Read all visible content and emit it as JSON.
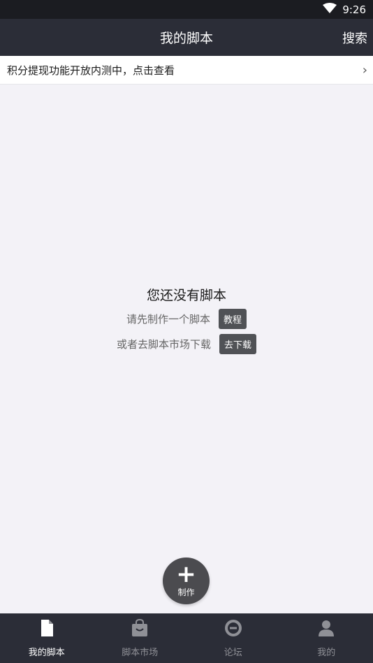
{
  "status": {
    "time": "9:26"
  },
  "header": {
    "title": "我的脚本",
    "search_label": "搜索"
  },
  "notice": {
    "text": "积分提现功能开放内测中，点击查看"
  },
  "empty": {
    "title": "您还没有脚本",
    "line1": "请先制作一个脚本",
    "tutorial_button": "教程",
    "line2": "或者去脚本市场下载",
    "download_button": "去下载"
  },
  "fab": {
    "label": "制作"
  },
  "nav": {
    "items": [
      {
        "label": "我的脚本",
        "icon": "file-icon",
        "active": true
      },
      {
        "label": "脚本市场",
        "icon": "shopping-bag-icon",
        "active": false
      },
      {
        "label": "论坛",
        "icon": "forum-icon",
        "active": false
      },
      {
        "label": "我的",
        "icon": "person-icon",
        "active": false
      }
    ]
  }
}
